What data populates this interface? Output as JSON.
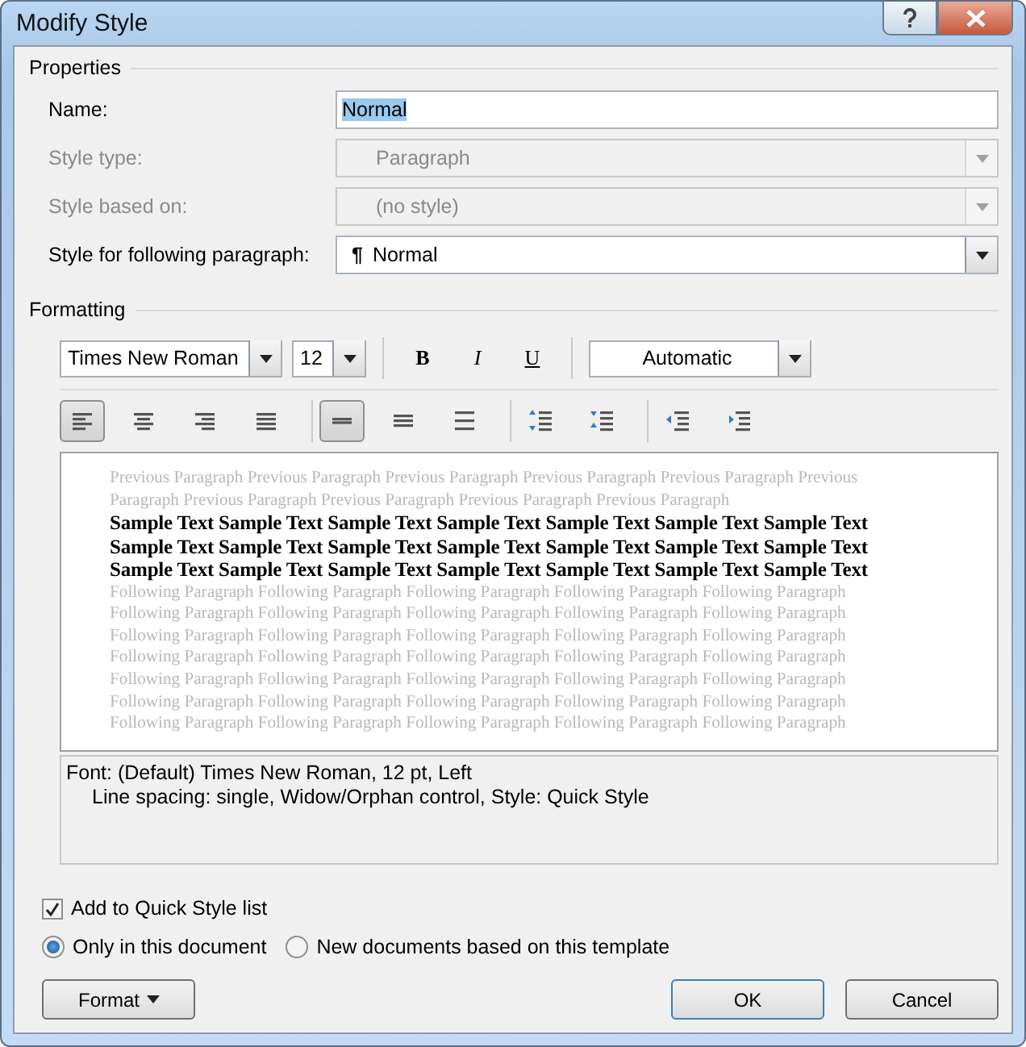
{
  "window": {
    "title": "Modify Style"
  },
  "properties": {
    "heading": "Properties",
    "fields": [
      {
        "label": "Name:",
        "kind": "text",
        "value": "Normal",
        "disabled": false
      },
      {
        "label": "Style type:",
        "kind": "combo",
        "value": "Paragraph",
        "disabled": true
      },
      {
        "label": "Style based on:",
        "kind": "combo",
        "value": "(no style)",
        "disabled": true
      },
      {
        "label": "Style for following paragraph:",
        "kind": "combo",
        "value": "Normal",
        "disabled": false,
        "pilcrow": "¶"
      }
    ]
  },
  "formatting": {
    "heading": "Formatting",
    "font": "Times New Roman",
    "size": "12",
    "color_label": "Automatic",
    "styles": [
      {
        "kind": "bold",
        "glyph": "B",
        "selected": false
      },
      {
        "kind": "italic",
        "glyph": "I",
        "selected": false
      },
      {
        "kind": "underline",
        "glyph": "U",
        "selected": false
      }
    ],
    "alignments": [
      {
        "kind": "left",
        "selected": true
      },
      {
        "kind": "center",
        "selected": false
      },
      {
        "kind": "right",
        "selected": false
      },
      {
        "kind": "justify",
        "selected": false
      }
    ],
    "spacing": [
      {
        "kind": "single",
        "selected": true
      },
      {
        "kind": "onehalf",
        "selected": false
      },
      {
        "kind": "double",
        "selected": false
      }
    ],
    "paragraph": [
      {
        "kind": "increase-spacing"
      },
      {
        "kind": "decrease-spacing"
      },
      {
        "kind": "decrease-indent"
      },
      {
        "kind": "increase-indent"
      }
    ]
  },
  "preview": [
    {
      "kind": "previous",
      "lines": [
        "Previous Paragraph Previous Paragraph Previous Paragraph Previous Paragraph Previous Paragraph Previous",
        "Paragraph Previous Paragraph Previous Paragraph Previous Paragraph Previous Paragraph"
      ]
    },
    {
      "kind": "sample",
      "lines": [
        "Sample Text Sample Text Sample Text Sample Text Sample Text Sample Text Sample Text",
        "Sample Text Sample Text Sample Text Sample Text Sample Text Sample Text Sample Text",
        "Sample Text Sample Text Sample Text Sample Text Sample Text Sample Text Sample Text"
      ]
    },
    {
      "kind": "following",
      "lines": [
        "Following Paragraph Following Paragraph Following Paragraph Following Paragraph Following Paragraph",
        "Following Paragraph Following Paragraph Following Paragraph Following Paragraph Following Paragraph",
        "Following Paragraph Following Paragraph Following Paragraph Following Paragraph Following Paragraph",
        "Following Paragraph Following Paragraph Following Paragraph Following Paragraph Following Paragraph",
        "Following Paragraph Following Paragraph Following Paragraph Following Paragraph Following Paragraph",
        "Following Paragraph Following Paragraph Following Paragraph Following Paragraph Following Paragraph",
        "Following Paragraph Following Paragraph Following Paragraph Following Paragraph Following Paragraph"
      ]
    }
  ],
  "description": [
    "Font: (Default) Times New Roman, 12 pt, Left",
    "Line spacing:  single, Widow/Orphan control, Style: Quick Style"
  ],
  "add_to_quick_style": {
    "label": "Add to Quick Style list",
    "checked": true
  },
  "scope": [
    {
      "label": "Only in this document",
      "selected": true
    },
    {
      "label": "New documents based on this template",
      "selected": false
    }
  ],
  "buttons": {
    "format": "Format",
    "ok": "OK",
    "cancel": "Cancel"
  }
}
